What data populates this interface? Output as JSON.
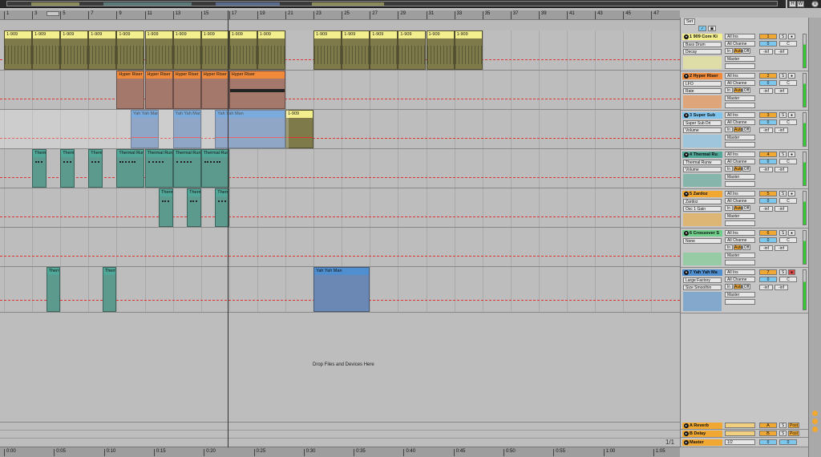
{
  "ruler": {
    "bars": [
      "1",
      "3",
      "5",
      "7",
      "9",
      "11",
      "13",
      "15",
      "17",
      "19",
      "21",
      "23",
      "25",
      "27",
      "29",
      "31",
      "33",
      "35",
      "37",
      "39",
      "41",
      "43",
      "45",
      "47"
    ]
  },
  "time_ruler": {
    "labels": [
      "0:00",
      "0:05",
      "0:10",
      "0:15",
      "0:20",
      "0:25",
      "0:30",
      "0:35",
      "0:40",
      "0:45",
      "0:50",
      "0:55",
      "1:00",
      "1:05"
    ]
  },
  "drop_zone": "Drop Files and Devices Here",
  "set_label": "Set",
  "page_indicator": "1/1",
  "header_buttons": [
    "H",
    "W"
  ],
  "tracks": [
    {
      "name": "1 909 Core Ki",
      "color": "#f3ee8e",
      "device": "Bass Drum",
      "param": "Decay",
      "input": "All Ins",
      "channel": "All Channe",
      "monitor": [
        "In",
        "Auto",
        "Off"
      ],
      "output": "Master",
      "number": "1",
      "solo": "S",
      "vol": "0",
      "pan": "C",
      "sends": [
        "-inf",
        "-inf"
      ],
      "clips": [
        {
          "label": "1-909",
          "color": "#f3ee8e",
          "body": "#7e7a4a"
        },
        {
          "label": "1-909",
          "color": "#f3ee8e",
          "body": "#7e7a4a"
        },
        {
          "label": "1-909",
          "color": "#f3ee8e",
          "body": "#7e7a4a"
        },
        {
          "label": "1-909",
          "color": "#f3ee8e",
          "body": "#7e7a4a"
        },
        {
          "label": "1-909",
          "color": "#f3ee8e",
          "body": "#7e7a4a"
        },
        {
          "label": "1-909",
          "color": "#f3ee8e",
          "body": "#7e7a4a"
        },
        {
          "label": "1-909",
          "color": "#f3ee8e",
          "body": "#7e7a4a"
        },
        {
          "label": "1-909",
          "color": "#f3ee8e",
          "body": "#7e7a4a"
        },
        {
          "label": "1-909",
          "color": "#f3ee8e",
          "body": "#7e7a4a"
        },
        {
          "label": "1-909",
          "color": "#f3ee8e",
          "body": "#7e7a4a"
        },
        {
          "label": "1-909",
          "color": "#f3ee8e",
          "body": "#7e7a4a"
        },
        {
          "label": "1-909",
          "color": "#f3ee8e",
          "body": "#7e7a4a"
        },
        {
          "label": "1-909",
          "color": "#f3ee8e",
          "body": "#7e7a4a"
        },
        {
          "label": "1-909",
          "color": "#f3ee8e",
          "body": "#7e7a4a"
        },
        {
          "label": "1-909",
          "color": "#f3ee8e",
          "body": "#7e7a4a"
        },
        {
          "label": "1-909",
          "color": "#f3ee8e",
          "body": "#7e7a4a"
        },
        {
          "label": "1-909",
          "color": "#f3ee8e",
          "body": "#7e7a4a"
        },
        {
          "label": "1-909",
          "color": "#f3ee8e",
          "body": "#7e7a4a"
        },
        {
          "label": "1-909",
          "color": "#f3ee8e",
          "body": "#7e7a4a"
        },
        {
          "label": "1-909",
          "color": "#f3ee8e",
          "body": "#7e7a4a"
        }
      ]
    },
    {
      "name": "2 Hyper Riser",
      "color": "#f08a3a",
      "device": "LFO",
      "param": "Rate",
      "input": "All Ins",
      "channel": "All Channe",
      "monitor": [
        "In",
        "Auto",
        "Off"
      ],
      "output": "Master",
      "number": "2",
      "solo": "S",
      "vol": "0",
      "pan": "C",
      "sends": [
        "-inf",
        "-inf"
      ],
      "clips": [
        {
          "label": "Hyper Riser",
          "color": "#f08a3a",
          "body": "#a4786a"
        },
        {
          "label": "Hyper Riser",
          "color": "#f08a3a",
          "body": "#a4786a"
        },
        {
          "label": "Hyper Riser",
          "color": "#f08a3a",
          "body": "#a4786a"
        },
        {
          "label": "Hyper Riser",
          "color": "#f08a3a",
          "body": "#a4786a"
        },
        {
          "label": "Hyper Riser",
          "color": "#f08a3a",
          "body": "#a4786a"
        },
        {
          "label": "Hyper Riser 2",
          "color": "#f08a3a",
          "body": "#a4786a"
        }
      ]
    },
    {
      "name": "3 Super Sub",
      "color": "#7fc4ef",
      "device": "Super Sub Dri",
      "param": "Volume",
      "input": "All Ins",
      "channel": "All Channe",
      "monitor": [
        "In",
        "Auto",
        "Off"
      ],
      "output": "Master",
      "number": "3",
      "solo": "S",
      "vol": "0",
      "pan": "C",
      "sends": [
        "-inf",
        "-inf"
      ],
      "clips": [
        {
          "label": "Yah Yah Man",
          "color": "#4f8fd0",
          "body": "#6b88b4"
        },
        {
          "label": "Yah Yah Man",
          "color": "#4f8fd0",
          "body": "#6b88b4"
        },
        {
          "label": "Yah Yah Man",
          "color": "#4f8fd0",
          "body": "#6b88b4"
        },
        {
          "label": "1-909",
          "color": "#f3ee8e",
          "body": "#7e7a4a"
        },
        {
          "label": "1-909",
          "color": "#f3ee8e",
          "body": "#7e7a4a"
        }
      ]
    },
    {
      "name": "4 Thermal Ru",
      "color": "#52a898",
      "device": "Thermal Runw",
      "param": "Volume",
      "input": "All Ins",
      "channel": "All Channe",
      "monitor": [
        "In",
        "Auto",
        "Off"
      ],
      "output": "Master",
      "number": "4",
      "solo": "S",
      "vol": "0",
      "pan": "C",
      "sends": [
        "-inf",
        "-inf"
      ],
      "clips": [
        {
          "label": "Therm",
          "color": "#52a898",
          "body": "#5d9a8e"
        },
        {
          "label": "Therm",
          "color": "#52a898",
          "body": "#5d9a8e"
        },
        {
          "label": "Therm",
          "color": "#52a898",
          "body": "#5d9a8e"
        },
        {
          "label": "Thermal Run",
          "color": "#52a898",
          "body": "#5d9a8e"
        },
        {
          "label": "Thermal Run",
          "color": "#52a898",
          "body": "#5d9a8e"
        },
        {
          "label": "Thermal Run",
          "color": "#52a898",
          "body": "#5d9a8e"
        },
        {
          "label": "Thermal Run",
          "color": "#52a898",
          "body": "#5d9a8e"
        }
      ]
    },
    {
      "name": "5 Zardoz",
      "color": "#f0a832",
      "device": "Zardoz",
      "param": "Osc 1 Gain",
      "input": "All Ins",
      "channel": "All Channe",
      "monitor": [
        "In",
        "Auto",
        "Off"
      ],
      "output": "Master",
      "number": "5",
      "solo": "S",
      "vol": "0",
      "pan": "C",
      "sends": [
        "-inf",
        "-inf"
      ],
      "clips": [
        {
          "label": "Therm",
          "color": "#52a898",
          "body": "#5d9a8e"
        },
        {
          "label": "Therm",
          "color": "#52a898",
          "body": "#5d9a8e"
        },
        {
          "label": "Therm",
          "color": "#52a898",
          "body": "#5d9a8e"
        }
      ]
    },
    {
      "name": "6 Crossover S",
      "color": "#6fcf8a",
      "device": "None",
      "param": "",
      "input": "All Ins",
      "channel": "All Channe",
      "monitor": [
        "In",
        "Auto",
        "Off"
      ],
      "output": "Master",
      "number": "6",
      "solo": "S",
      "vol": "0",
      "pan": "C",
      "sends": [
        "-inf",
        "-inf"
      ],
      "clips": []
    },
    {
      "name": "7 Yah Yah Ma",
      "color": "#4f8fd0",
      "device": "Large Factory",
      "param": "Size Smoothin",
      "input": "All Ins",
      "channel": "All Channe",
      "monitor": [
        "In",
        "Auto",
        "Off"
      ],
      "output": "Master",
      "number": "7",
      "solo": "S",
      "vol": "0",
      "pan": "C",
      "sends": [
        "-inf",
        "-inf"
      ],
      "clips": [
        {
          "label": "Therm",
          "color": "#52a898",
          "body": "#5d9a8e"
        },
        {
          "label": "Therm",
          "color": "#52a898",
          "body": "#5d9a8e"
        },
        {
          "label": "Yah Yah Man",
          "color": "#4f8fd0",
          "body": "#6b88b4"
        }
      ]
    }
  ],
  "returns": [
    {
      "name": "A Reverb",
      "letter": "A",
      "solo": "S",
      "mode": "Post"
    },
    {
      "name": "B Delay",
      "letter": "B",
      "solo": "S",
      "mode": "Post"
    }
  ],
  "master": {
    "name": "Master",
    "cue": "1/2",
    "vol": "0",
    "pan": "0"
  }
}
